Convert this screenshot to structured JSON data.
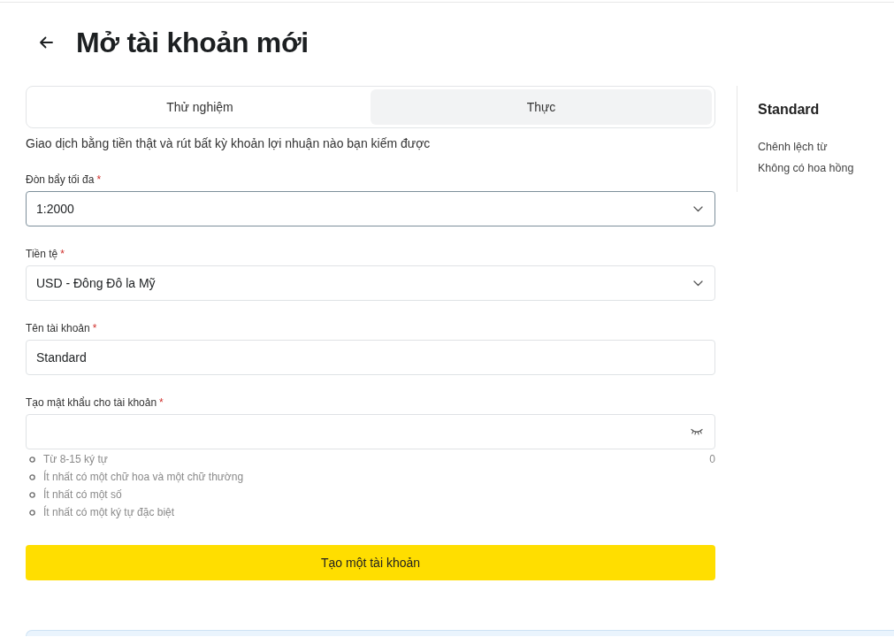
{
  "header": {
    "title": "Mở tài khoản mới"
  },
  "account_type_tabs": [
    {
      "label": "Thử nghiệm",
      "selected": false
    },
    {
      "label": "Thực",
      "selected": true
    }
  ],
  "description": "Giao dịch bằng tiền thật và rút bất kỳ khoản lợi nhuận nào bạn kiếm được",
  "fields": [
    {
      "kind": "select",
      "label": "Đòn bẩy tối đa",
      "required_mark": "*",
      "value": "1:2000",
      "focused": true
    },
    {
      "kind": "select",
      "label": "Tiền tệ",
      "required_mark": "*",
      "value": "USD - Đông Đô la Mỹ",
      "focused": false
    },
    {
      "kind": "text",
      "label": "Tên tài khoản",
      "required_mark": "*",
      "value": "Standard",
      "focused": false
    },
    {
      "kind": "password",
      "label": "Tạo mật khẩu cho tài khoản",
      "required_mark": "*",
      "focused": false,
      "char_count": "0",
      "hints": [
        "Từ 8-15 ký tự",
        "Ít nhất có một chữ hoa và một chữ thường",
        "Ít nhất có một số",
        "Ít nhất có một ký tự đặc biệt"
      ]
    }
  ],
  "submit_button": {
    "label": "Tạo một tài khoản"
  },
  "sidebar": {
    "title": "Standard",
    "lines": [
      "Chênh lệch từ",
      "Không có hoa hồng"
    ]
  }
}
